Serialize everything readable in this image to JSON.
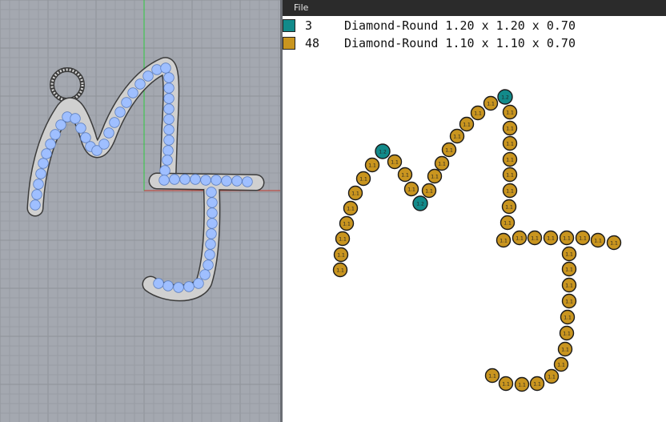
{
  "menu": {
    "file_label": "File"
  },
  "legend": [
    {
      "count": "3",
      "description": "Diamond-Round 1.20 x 1.20 x 0.70",
      "color": "#128a8a"
    },
    {
      "count": "48",
      "description": "Diamond-Round 1.10 x 1.10 x 0.70",
      "color": "#c9951f"
    }
  ],
  "viewport": {
    "background": "#a4a8b0",
    "stone_fill": "#9fbfff",
    "axis_x_color": "#c0392b",
    "axis_y_color": "#2ecc40"
  },
  "stones": {
    "large_label": "1.2",
    "small_label": "1.1"
  }
}
